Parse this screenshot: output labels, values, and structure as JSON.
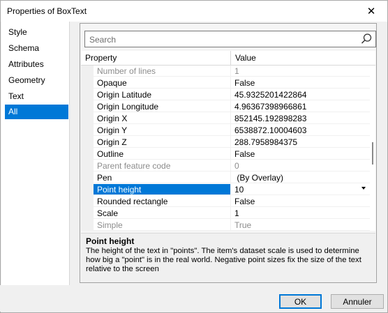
{
  "window": {
    "title": "Properties of BoxText"
  },
  "nav": {
    "items": [
      {
        "label": "Style"
      },
      {
        "label": "Schema"
      },
      {
        "label": "Attributes"
      },
      {
        "label": "Geometry"
      },
      {
        "label": "Text"
      },
      {
        "label": "All"
      }
    ],
    "selected": "All"
  },
  "search": {
    "placeholder": "Search"
  },
  "grid": {
    "columns": [
      "Property",
      "Value"
    ],
    "rows": [
      {
        "name": "Number of lines",
        "value": "1",
        "enabled": false
      },
      {
        "name": "Opaque",
        "value": "False",
        "enabled": true
      },
      {
        "name": "Origin Latitude",
        "value": "45.9325201422864",
        "enabled": true
      },
      {
        "name": "Origin Longitude",
        "value": "4.96367398966861",
        "enabled": true
      },
      {
        "name": "Origin X",
        "value": "852145.192898283",
        "enabled": true
      },
      {
        "name": "Origin Y",
        "value": "6538872.10004603",
        "enabled": true
      },
      {
        "name": "Origin Z",
        "value": "288.7958984375",
        "enabled": true
      },
      {
        "name": "Outline",
        "value": "False",
        "enabled": true
      },
      {
        "name": "Parent feature code",
        "value": "0",
        "enabled": false
      },
      {
        "name": "Pen",
        "value": " (By Overlay)",
        "enabled": true
      },
      {
        "name": "Point height",
        "value": "10",
        "enabled": true,
        "selected": true,
        "dropdown": true
      },
      {
        "name": "Rounded rectangle",
        "value": "False",
        "enabled": true
      },
      {
        "name": "Scale",
        "value": "1",
        "enabled": true
      },
      {
        "name": "Simple",
        "value": "True",
        "enabled": false
      }
    ]
  },
  "description": {
    "title": "Point height",
    "text": "The height of the text in \"points\". The item's dataset scale is used to determine how big a \"point\" is in the real world. Negative point sizes fix the size of the text relative to the screen"
  },
  "buttons": {
    "ok": "OK",
    "cancel": "Annuler"
  },
  "colors": {
    "accent": "#0078d7",
    "disabled_text": "#8c8c8c"
  }
}
